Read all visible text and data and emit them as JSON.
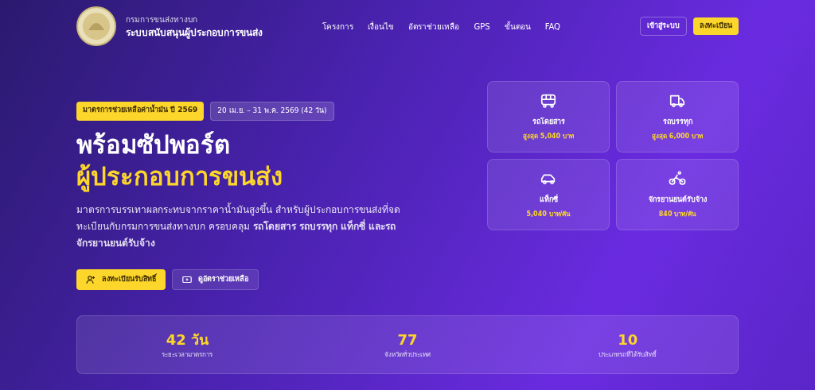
{
  "header": {
    "org": "กรมการขนส่งทางบก",
    "site_title": "ระบบสนับสนุนผู้ประกอบการขนส่ง",
    "nav": [
      "โครงการ",
      "เงื่อนไข",
      "อัตราช่วยเหลือ",
      "GPS",
      "ขั้นตอน",
      "FAQ"
    ],
    "login": "เข้าสู่ระบบ",
    "register": "ลงทะเบียน"
  },
  "hero": {
    "badge": "มาตรการช่วยเหลือค่าน้ำมัน ปี 2569",
    "period": "20 เม.ย. – 31 พ.ค. 2569 (42 วัน)",
    "title_line1": "พร้อมซัปพอร์ต",
    "title_line2": "ผู้ประกอบการขนส่ง",
    "description": "มาตรการบรรเทาผลกระทบจากราคาน้ำมันสูงขึ้น สำหรับผู้ประกอบการขนส่งที่จดทะเบียนกับกรมการขนส่งทางบก ครอบคลุม **รถโดยสาร รถบรรทุก แท็กซี่ และรถจักรยานยนต์รับจ้าง**",
    "primary_button": "ลงทะเบียนรับสิทธิ์",
    "secondary_button": "ดูอัตราช่วยเหลือ"
  },
  "vehicles": [
    {
      "kind": "bus",
      "name": "รถโดยสาร",
      "amount": "สูงสุด 5,040 บาท"
    },
    {
      "kind": "truck",
      "name": "รถบรรทุก",
      "amount": "สูงสุด 6,000 บาท"
    },
    {
      "kind": "car",
      "name": "แท็กซี่",
      "amount": "5,040 บาท/คัน"
    },
    {
      "kind": "motorbike",
      "name": "จักรยานยนต์รับจ้าง",
      "amount": "840 บาท/คัน"
    }
  ],
  "stats": [
    {
      "value": "42 วัน",
      "label": "ระยะเวลามาตรการ"
    },
    {
      "value": "77",
      "label": "จังหวัดทั่วประเทศ"
    },
    {
      "value": "10",
      "label": "ประเภทรถที่ได้รับสิทธิ์"
    }
  ]
}
